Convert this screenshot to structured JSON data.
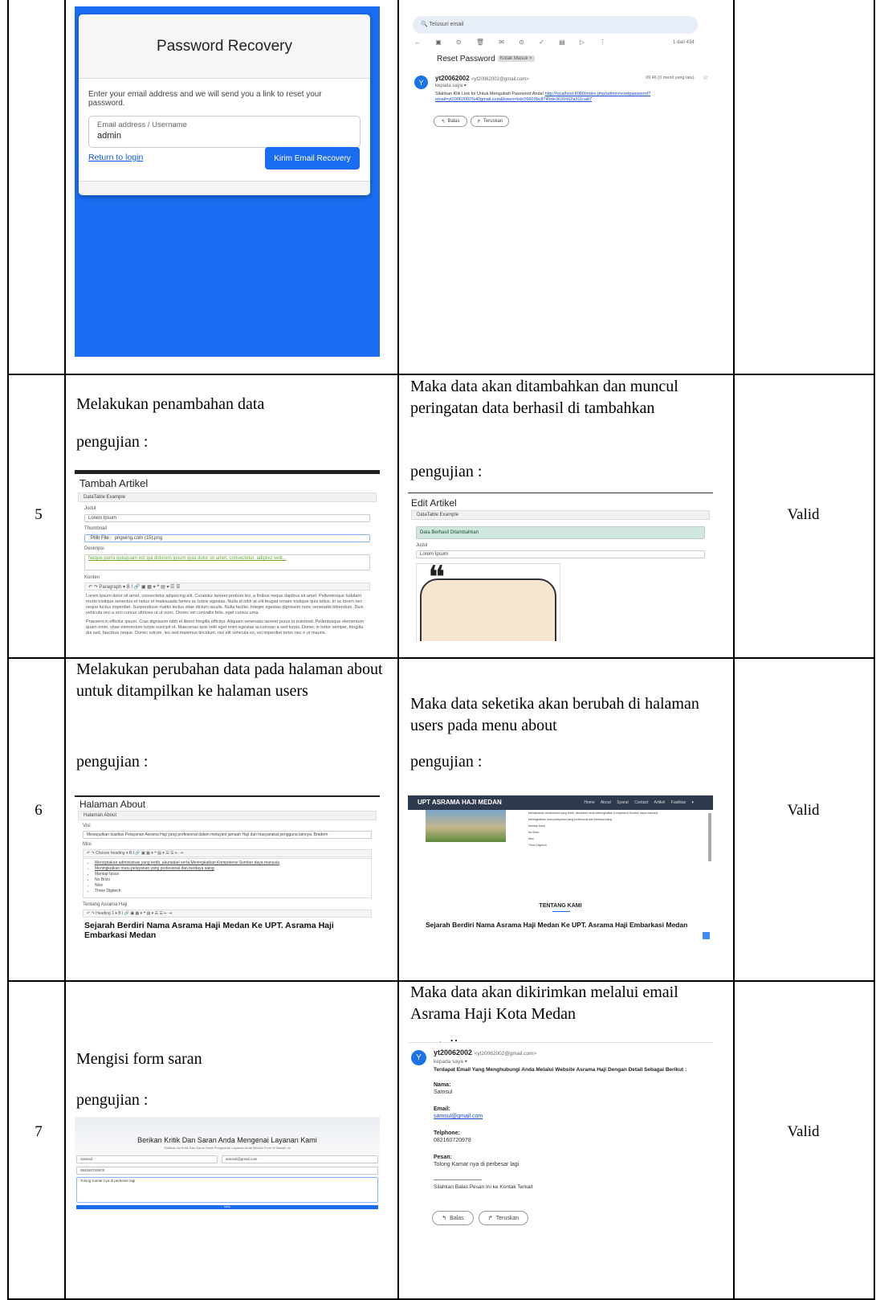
{
  "rows": [
    {
      "number": "",
      "test_step": "",
      "expected": "",
      "result": ""
    },
    {
      "number": "5",
      "test_step": "Melakukan penambahan data",
      "test_caption": "pengujian :",
      "expected": "Maka data akan ditambahkan dan muncul peringatan data berhasil di tambahkan",
      "expected_caption": "pengujian :",
      "result": "Valid"
    },
    {
      "number": "6",
      "test_step": "Melakukan perubahan data pada halaman about untuk ditampilkan ke halaman users",
      "test_caption": "pengujian :",
      "expected": "Maka data seketika akan berubah di halaman users pada menu about",
      "expected_caption": "pengujian :",
      "result": "Valid"
    },
    {
      "number": "7",
      "test_step": "Mengisi form saran",
      "test_caption": "pengujian :",
      "expected": "Maka data akan dikirimkan melalui email Asrama Haji Kota Medan",
      "expected_caption": "pengujian :",
      "result": "Valid"
    }
  ],
  "shot_password_recovery": {
    "title": "Password Recovery",
    "help": "Enter your email address and we will send you a link to reset your password.",
    "field_label": "Email address / Username",
    "field_value": "admin",
    "return_link": "Return to login",
    "submit_button": "Kirim Email Recovery"
  },
  "shot_gmail_reset": {
    "search_placeholder": "Telusuri email",
    "subject": "Reset Password",
    "tag": "Kotak Masuk ×",
    "sender": "yt20062002",
    "sender_email": "<yt20062002@gmail.com>",
    "to_me": "kepada saya ▾",
    "time": "09.46 (0 menit yang lalu)",
    "counter": "1 dari 434",
    "body": "Silahkan Klik Link Ini Untuk Mengubah Password Anda!",
    "link": "http://localhost:8080/index.php/admin/resetpassword?email=yt20062002%40gmail.com&token=bdc09603bc8749de3631662a311ca87",
    "reply": "Balas",
    "forward": "Teruskan"
  },
  "shot_tambah_artikel": {
    "title": "Tambah Artikel",
    "card_head": "DataTable Example",
    "judul_label": "Judul",
    "judul_value": "Lorem Ipsum",
    "thumb_label": "Thumbnail",
    "thumb_button": "Pilih File",
    "thumb_value": "pngwing.com (15).png",
    "deskripsi_label": "Deskripsi",
    "deskripsi_value": "Neque porro quisquam est qui dolorem ipsum quia dolor sit amet, consectetur, adipisci velit...",
    "konten_label": "Konten",
    "toolbar": "↶ ↷  Paragraph  ▾  B  I  🔗  ▣  ▦ ▾  ❝  ▤ ▾  ☰  ☰",
    "paragraph1": "Lorem ipsum dolor sit amet, consectetur adipiscing elit. Curabitur laoreet pretium leo, a finibus neque dapibus sit amet. Pellentesque habitant morbi tristique senectus et netus et malesuada fames ac turpis egestas. Nulla id nibh at elit feugiat ornare tristique quis tellus. In ac lorem nec neque luctus imperdiet. Suspendisse mattis lectus vitae dictum iaculis. Nulla facilisi. Integer egestas dignissim nunc venenatis bibendum. Duis vehicula orci a orci cursus ultricies ut ut nunc. Donec vel convallis felis, eget cursus urna.",
    "paragraph2": "Praesent in efficitur ipsum. Cras dignissim nibh et libero fringilla efficitur. Aliquam venenatis laoreet purus in euismod. Pellentesque elementum quam enim, vitae elementum turpis suscipit et. Maecenas quis velit eget enim egestas accumsan a sed turpis. Donec in tortor semper, fringilla dui sed, faucibus neque. Donec rutrum, leo sed maximus tincidunt, nisi elit vehicula ex, vel imperdiet tortor nec e ut mauris."
  },
  "shot_edit_artikel": {
    "title": "Edit Artikel",
    "card_head": "DataTable Example",
    "alert": "Data Berhasil Ditambahkan",
    "judul_label": "Judul",
    "judul_value": "Lorem Ipsum"
  },
  "shot_halaman_about": {
    "title": "Halaman About",
    "card_head": "Halaman About",
    "visi_label": "Visi",
    "visi_value": "Mewujudkan kualitas Pelayanan Asrama Haji yang profesional dalam melayani jamaah Haji dan masyarakat pengguna lainnya. Bradern",
    "misi_label": "Misi",
    "toolbar": "↶ ↷  Choose heading  ▾  B  I  🔗  ▣  ▦ ▾  ❝  ▤ ▾  ☰  ☰  ⇤  ⇥",
    "misi_items": [
      "Menciptakan administrasi yang tertib, akuntabel serta Meningkatkan Kompetensi Sumber daya manusia",
      "Meningkatkan mutu pelayanan yang profesional dan berdaya saing",
      "Mantap Ipsus",
      "No Brizo",
      "Nice",
      "Three Digitech"
    ],
    "tentang_label": "Tentang Asrama Haji",
    "tentang_toolbar": "↶ ↷  Heading 1  ▾  B  I  🔗  ▣  ▦ ▾  ❝  ▤ ▾  ☰  ☰  ⇤  ⇥",
    "heading": "Sejarah Berdiri Nama Asrama Haji Medan Ke UPT. Asrama Haji Embarkasi Medan"
  },
  "shot_users_about": {
    "brand": "UPT ASRAMA HAJI MEDAN",
    "menu": "Home  About  Syarat  Contact  Artikel  Fasilitas ▾",
    "list": [
      "Menciptakan administrasi yang tertib, akuntabel serta Meningkatkan Kompetensi Sumber daya manusia",
      "Meningkatkan mutu pelayanan yang profesional dan berdaya saing",
      "Mantap Ipsus",
      "No Brizo",
      "Nice",
      "Three Digitech"
    ],
    "section_title": "TENTANG KAMI",
    "heading": "Sejarah Berdiri Nama Asrama Haji Medan Ke UPT. Asrama Haji Embarkasi Medan"
  },
  "shot_saran_form": {
    "title": "Berikan Kritik Dan Saran Anda Mengenai Layanan Kami",
    "subtitle": "Silahkan Isi Kritik Dan Saran Serta Pengaduan Layanan Anda Melalui Form Di Bawah Ini",
    "name_value": "Samsul",
    "email_value": "samsul@gmail.com",
    "phone_value": "082160720978",
    "message_value": "Tolong Kamar nya di perbesar lagi",
    "send_button": "SEND"
  },
  "shot_gmail_saran": {
    "sender": "yt20062002",
    "sender_email": "<yt20062002@gmail.com>",
    "to_me": "kepada saya ▾",
    "intro": "Terdapat Email Yang Menghubungi Anda Melalui Website Asrama Haji Dengan Detail Sebagai Berikut :",
    "nama_label": "Nama:",
    "nama_value": "Samsul",
    "email_label": "Email:",
    "email_value": "samsul@gmail.com",
    "telp_label": "Telphone:",
    "telp_value": "082160720978",
    "pesan_label": "Pesan:",
    "pesan_value": "Tolong Kamar nya di perbesar lagi",
    "closing": "Silahkan Balas Pesan Ini ke Kontak Terkait",
    "reply": "Balas",
    "forward": "Teruskan"
  }
}
